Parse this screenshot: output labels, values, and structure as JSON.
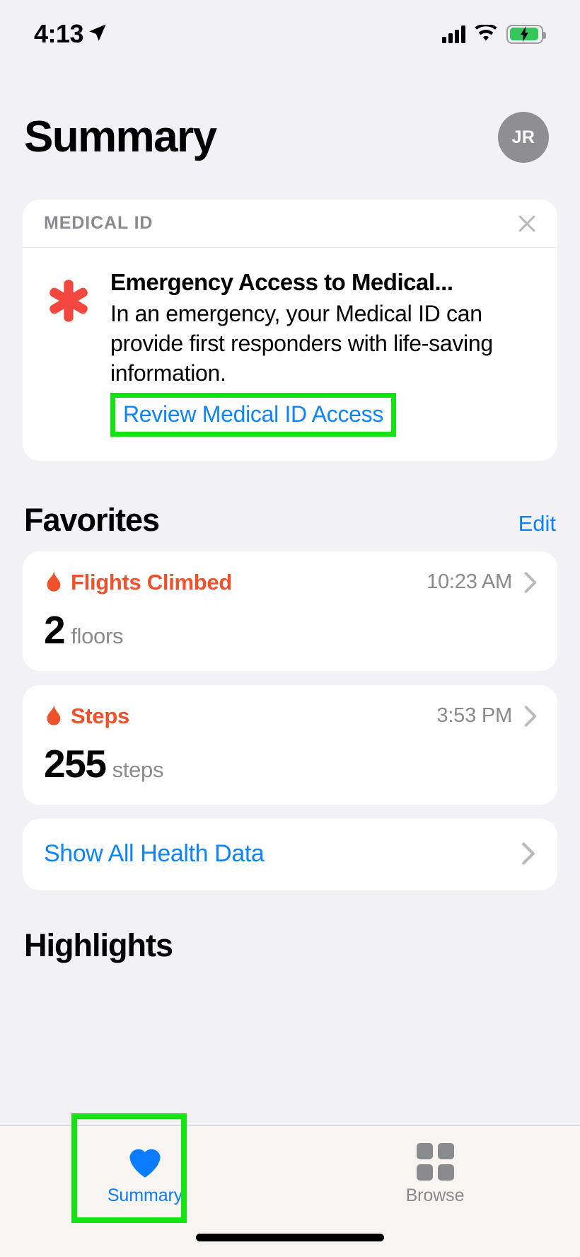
{
  "status_bar": {
    "time": "4:13",
    "location_icon": "location-arrow-icon",
    "signal_icon": "cellular-signal-icon",
    "wifi_icon": "wifi-icon",
    "battery_icon": "battery-charging-icon",
    "battery_color": "#34c759"
  },
  "header": {
    "title": "Summary",
    "avatar_initials": "JR"
  },
  "medical_id_card": {
    "section_label": "MEDICAL ID",
    "close_icon": "close-icon",
    "star_icon": "medical-star-icon",
    "star_color": "#f4473f",
    "title": "Emergency Access to Medical...",
    "description": "In an emergency, your Medical ID can provide first responders with life-saving information.",
    "link_label": "Review Medical ID Access",
    "link_color": "#0a84ff",
    "highlight_color": "#13e313"
  },
  "favorites": {
    "title": "Favorites",
    "edit_label": "Edit",
    "accent_color": "#f1512a",
    "items": [
      {
        "icon": "flame-icon",
        "name": "Flights Climbed",
        "time": "10:23 AM",
        "value": "2",
        "unit": "floors",
        "chevron": "chevron-right-icon"
      },
      {
        "icon": "flame-icon",
        "name": "Steps",
        "time": "3:53 PM",
        "value": "255",
        "unit": "steps",
        "chevron": "chevron-right-icon"
      }
    ],
    "show_all_label": "Show All Health Data",
    "show_all_chevron": "chevron-right-icon"
  },
  "highlights": {
    "title": "Highlights"
  },
  "tab_bar": {
    "tabs": [
      {
        "label": "Summary",
        "icon": "heart-icon",
        "active": true
      },
      {
        "label": "Browse",
        "icon": "grid-icon",
        "active": false
      }
    ],
    "active_color": "#0a7cff",
    "inactive_color": "#8a8a8e",
    "highlight_color": "#13e313"
  }
}
